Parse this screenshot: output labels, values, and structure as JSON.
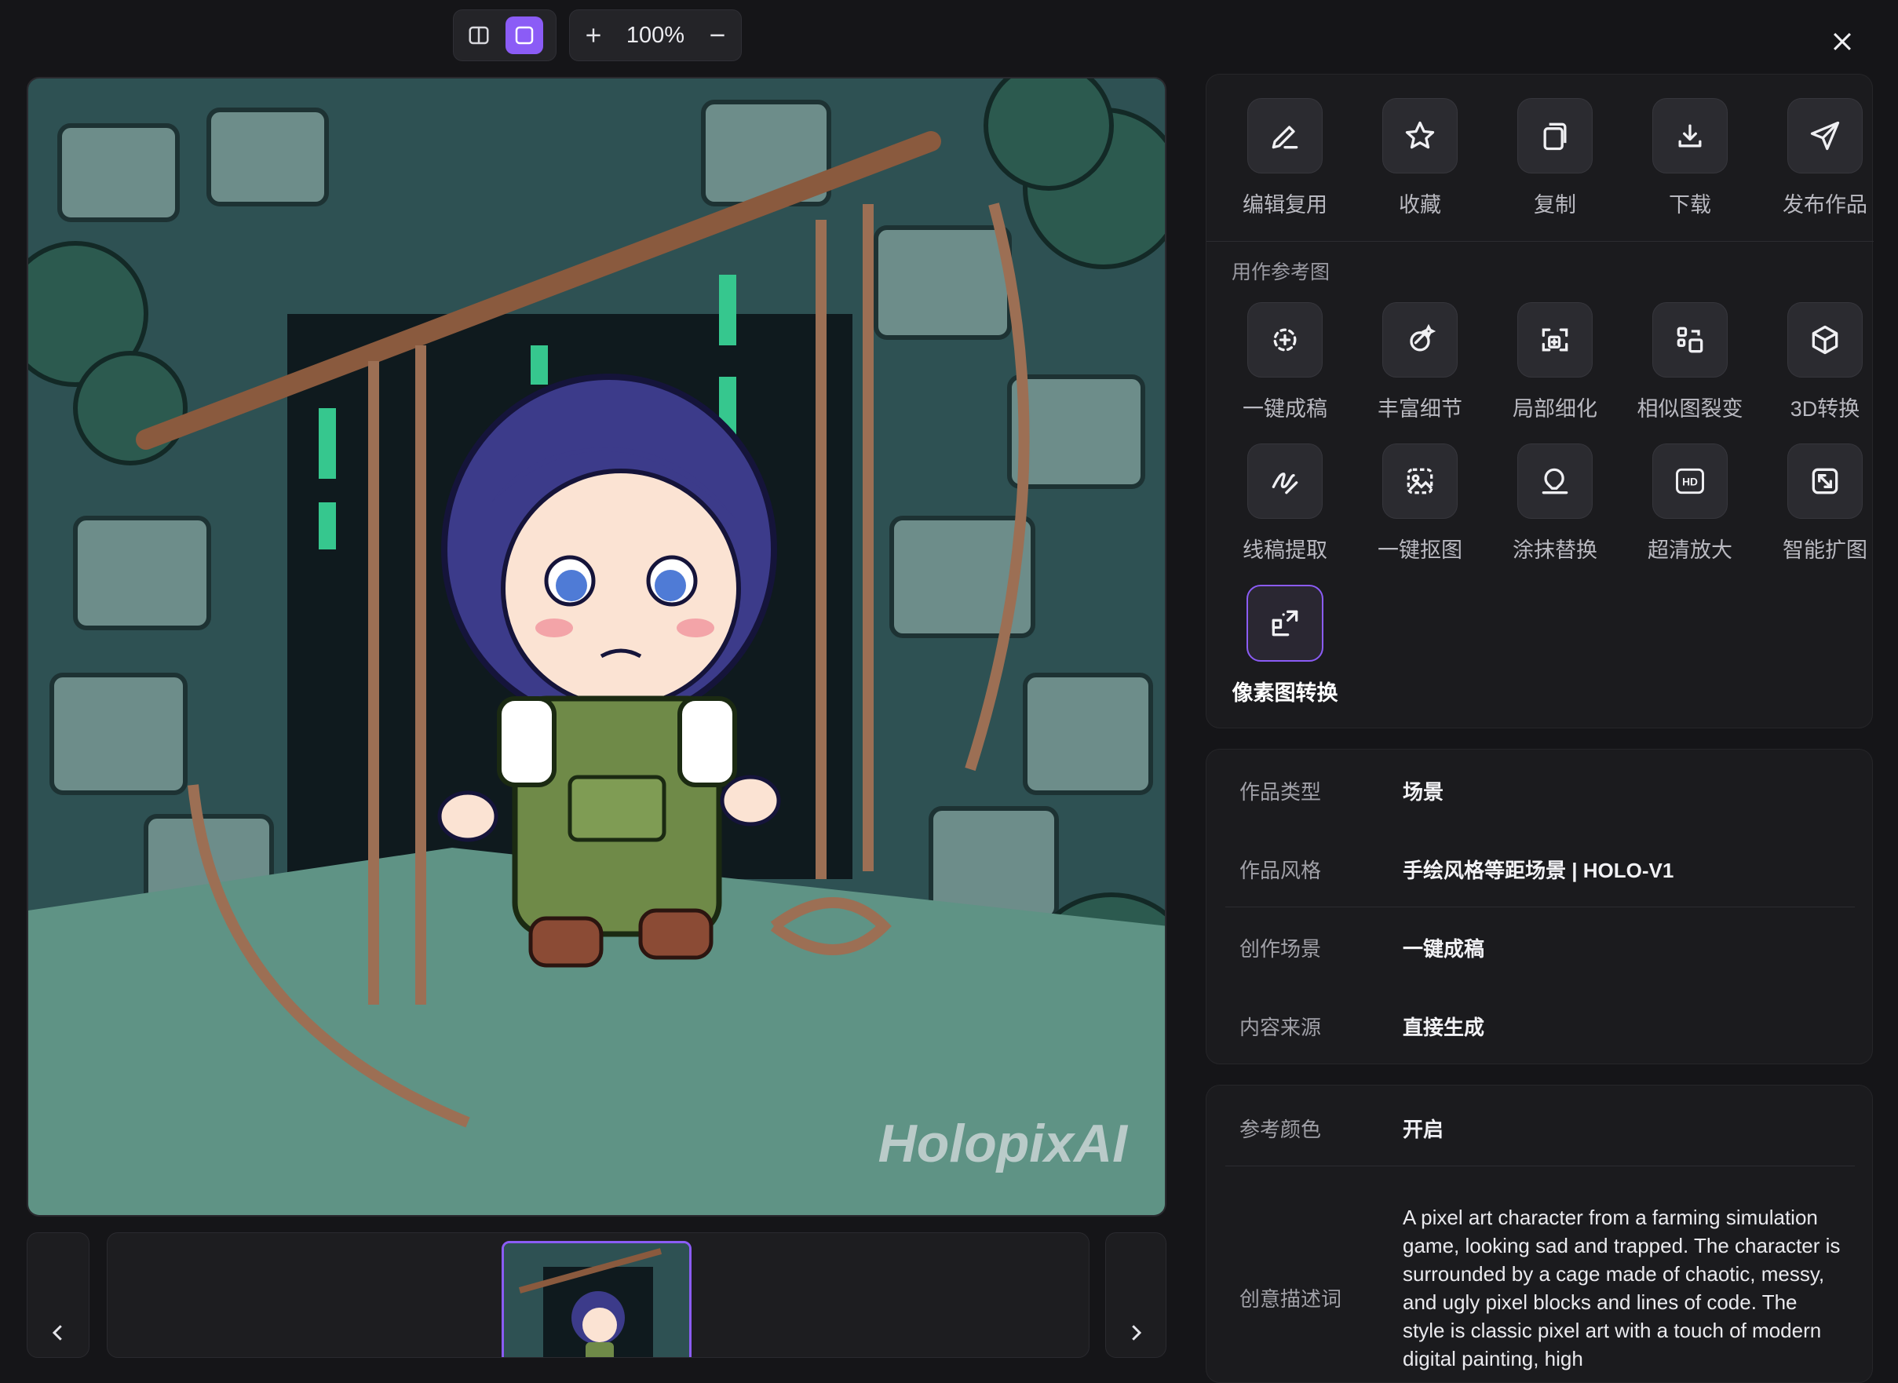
{
  "toolbar": {
    "zoom": "100%",
    "icons": {
      "split": "split-view-icon",
      "single": "single-view-icon",
      "plus": "zoom-in-icon",
      "minus": "zoom-out-icon",
      "close": "close-icon"
    }
  },
  "preview": {
    "watermark": "HolopixAI"
  },
  "actions": [
    {
      "label": "编辑复用",
      "icon": "pencil-icon"
    },
    {
      "label": "收藏",
      "icon": "star-icon"
    },
    {
      "label": "复制",
      "icon": "copy-icon"
    },
    {
      "label": "下载",
      "icon": "download-icon"
    },
    {
      "label": "发布作品",
      "icon": "send-icon"
    }
  ],
  "reference": {
    "title": "用作参考图",
    "tools": [
      {
        "label": "一键成稿",
        "icon": "one-click-draft-icon"
      },
      {
        "label": "丰富细节",
        "icon": "enrich-detail-icon"
      },
      {
        "label": "局部细化",
        "icon": "local-refine-icon"
      },
      {
        "label": "相似图裂变",
        "icon": "similar-variation-icon"
      },
      {
        "label": "3D转换",
        "icon": "3d-cube-icon"
      },
      {
        "label": "线稿提取",
        "icon": "lineart-icon"
      },
      {
        "label": "一键抠图",
        "icon": "cutout-icon"
      },
      {
        "label": "涂抹替换",
        "icon": "smear-replace-icon"
      },
      {
        "label": "超清放大",
        "icon": "hd-upscale-icon"
      },
      {
        "label": "智能扩图",
        "icon": "expand-image-icon"
      },
      {
        "label": "像素图转换",
        "icon": "pixel-convert-icon"
      }
    ]
  },
  "info": [
    {
      "key": "作品类型",
      "value": "场景"
    },
    {
      "key": "作品风格",
      "value": "手绘风格等距场景 | HOLO-V1"
    },
    {
      "key": "创作场景",
      "value": "一键成稿"
    },
    {
      "key": "内容来源",
      "value": "直接生成"
    }
  ],
  "params": {
    "color_key": "参考颜色",
    "color_value": "开启",
    "prompt_key": "创意描述词",
    "prompt_value": "A pixel art character from a farming simulation game, looking sad and trapped. The character is surrounded by a cage made of chaotic, messy, and ugly pixel blocks and lines of code. The style is classic pixel art with a touch of modern digital painting, high"
  }
}
